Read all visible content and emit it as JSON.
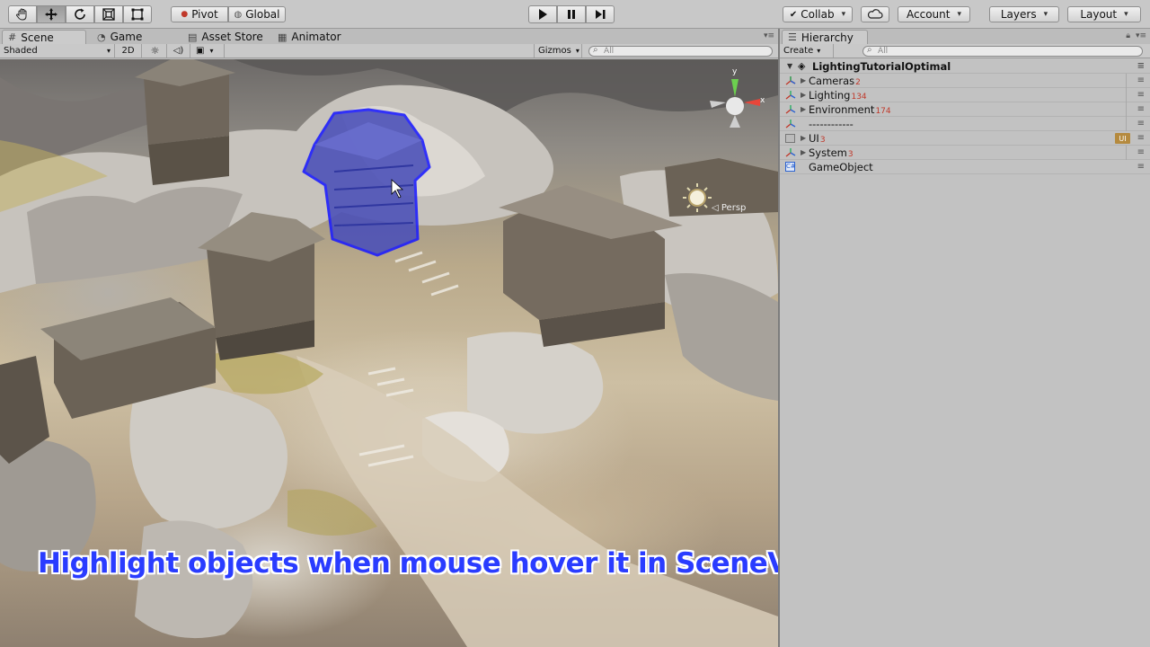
{
  "toolbar": {
    "pivot": "Pivot",
    "global": "Global",
    "collab": "Collab",
    "account": "Account",
    "layers": "Layers",
    "layout": "Layout"
  },
  "scene_tabs": {
    "scene": "Scene",
    "game": "Game",
    "asset_store": "Asset Store",
    "animator": "Animator"
  },
  "scene_bar": {
    "shading": "Shaded",
    "mode_2d": "2D",
    "gizmos": "Gizmos",
    "search_placeholder": "All"
  },
  "viewport": {
    "persp_label": "Persp",
    "caption": "Highlight objects when mouse hover it in SceneView",
    "highlight_color": "#1a1aff"
  },
  "hierarchy": {
    "tab": "Hierarchy",
    "create": "Create",
    "search_placeholder": "All",
    "scene_name": "LightingTutorialOptimal",
    "rows": [
      {
        "label": "Cameras",
        "count": "2"
      },
      {
        "label": "Lighting",
        "count": "134"
      },
      {
        "label": "Environment",
        "count": "174"
      },
      {
        "label": "------------",
        "count": ""
      },
      {
        "label": "UI",
        "count": "3",
        "tag": "UI"
      },
      {
        "label": "System",
        "count": "3"
      },
      {
        "label": "GameObject",
        "count": ""
      }
    ]
  }
}
